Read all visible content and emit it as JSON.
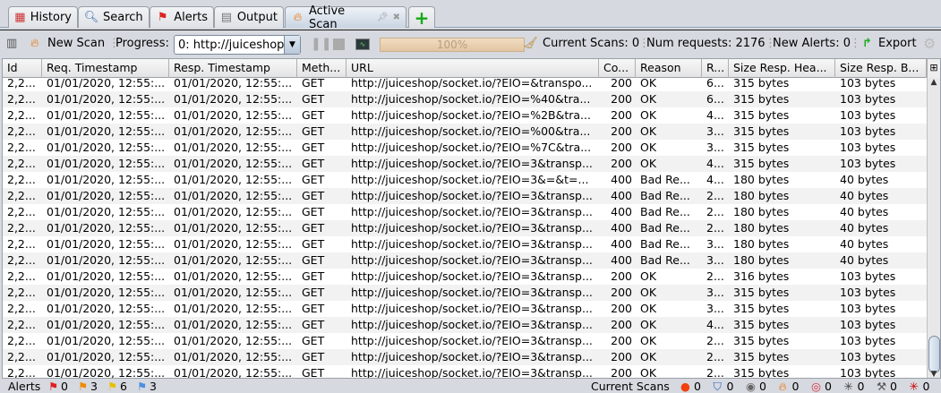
{
  "tabs": [
    {
      "label": "History",
      "icon": "calendar-icon"
    },
    {
      "label": "Search",
      "icon": "magnifier-icon"
    },
    {
      "label": "Alerts",
      "icon": "flag-icon"
    },
    {
      "label": "Output",
      "icon": "document-icon"
    },
    {
      "label": "Active Scan",
      "icon": "flame-icon",
      "active": true
    }
  ],
  "toolbar": {
    "new_scan": "New Scan",
    "progress_label": "Progress:",
    "progress_select": "0: http://juiceshop",
    "progress_value": "100%",
    "progress_percent": 100,
    "current_scans": "Current Scans: 0",
    "num_requests": "Num requests: 2176",
    "new_alerts": "New Alerts: 0",
    "export": "Export"
  },
  "table": {
    "columns": [
      "Id",
      "Req. Timestamp",
      "Resp. Timestamp",
      "Meth...",
      "URL",
      "Co...",
      "Reason",
      "R...",
      "Size Resp. Hea...",
      "Size Resp. B..."
    ],
    "rows": [
      [
        "2,2...",
        "01/01/2020, 12:55:...",
        "01/01/2020, 12:55:...",
        "GET",
        "http://juiceshop/socket.io/?EIO=&transpo...",
        "200",
        "OK",
        "6...",
        "315 bytes",
        "103 bytes"
      ],
      [
        "2,2...",
        "01/01/2020, 12:55:...",
        "01/01/2020, 12:55:...",
        "GET",
        "http://juiceshop/socket.io/?EIO=%40&tra...",
        "200",
        "OK",
        "6...",
        "315 bytes",
        "103 bytes"
      ],
      [
        "2,2...",
        "01/01/2020, 12:55:...",
        "01/01/2020, 12:55:...",
        "GET",
        "http://juiceshop/socket.io/?EIO=%2B&tra...",
        "200",
        "OK",
        "4...",
        "315 bytes",
        "103 bytes"
      ],
      [
        "2,2...",
        "01/01/2020, 12:55:...",
        "01/01/2020, 12:55:...",
        "GET",
        "http://juiceshop/socket.io/?EIO=%00&tra...",
        "200",
        "OK",
        "3...",
        "315 bytes",
        "103 bytes"
      ],
      [
        "2,2...",
        "01/01/2020, 12:55:...",
        "01/01/2020, 12:55:...",
        "GET",
        "http://juiceshop/socket.io/?EIO=%7C&tra...",
        "200",
        "OK",
        "3...",
        "315 bytes",
        "103 bytes"
      ],
      [
        "2,2...",
        "01/01/2020, 12:55:...",
        "01/01/2020, 12:55:...",
        "GET",
        "http://juiceshop/socket.io/?EIO=3&transp...",
        "200",
        "OK",
        "4...",
        "315 bytes",
        "103 bytes"
      ],
      [
        "2,2...",
        "01/01/2020, 12:55:...",
        "01/01/2020, 12:55:...",
        "GET",
        "http://juiceshop/socket.io/?EIO=3&=&t=...",
        "400",
        "Bad Re...",
        "4...",
        "180 bytes",
        "40 bytes"
      ],
      [
        "2,2...",
        "01/01/2020, 12:55:...",
        "01/01/2020, 12:55:...",
        "GET",
        "http://juiceshop/socket.io/?EIO=3&transp...",
        "400",
        "Bad Re...",
        "2...",
        "180 bytes",
        "40 bytes"
      ],
      [
        "2,2...",
        "01/01/2020, 12:55:...",
        "01/01/2020, 12:55:...",
        "GET",
        "http://juiceshop/socket.io/?EIO=3&transp...",
        "400",
        "Bad Re...",
        "2...",
        "180 bytes",
        "40 bytes"
      ],
      [
        "2,2...",
        "01/01/2020, 12:55:...",
        "01/01/2020, 12:55:...",
        "GET",
        "http://juiceshop/socket.io/?EIO=3&transp...",
        "400",
        "Bad Re...",
        "2...",
        "180 bytes",
        "40 bytes"
      ],
      [
        "2,2...",
        "01/01/2020, 12:55:...",
        "01/01/2020, 12:55:...",
        "GET",
        "http://juiceshop/socket.io/?EIO=3&transp...",
        "400",
        "Bad Re...",
        "3...",
        "180 bytes",
        "40 bytes"
      ],
      [
        "2,2...",
        "01/01/2020, 12:55:...",
        "01/01/2020, 12:55:...",
        "GET",
        "http://juiceshop/socket.io/?EIO=3&transp...",
        "400",
        "Bad Re...",
        "3...",
        "180 bytes",
        "40 bytes"
      ],
      [
        "2,2...",
        "01/01/2020, 12:55:...",
        "01/01/2020, 12:55:...",
        "GET",
        "http://juiceshop/socket.io/?EIO=3&transp...",
        "200",
        "OK",
        "2...",
        "316 bytes",
        "103 bytes"
      ],
      [
        "2,2...",
        "01/01/2020, 12:55:...",
        "01/01/2020, 12:55:...",
        "GET",
        "http://juiceshop/socket.io/?EIO=3&transp...",
        "200",
        "OK",
        "3...",
        "315 bytes",
        "103 bytes"
      ],
      [
        "2,2...",
        "01/01/2020, 12:55:...",
        "01/01/2020, 12:55:...",
        "GET",
        "http://juiceshop/socket.io/?EIO=3&transp...",
        "200",
        "OK",
        "3...",
        "315 bytes",
        "103 bytes"
      ],
      [
        "2,2...",
        "01/01/2020, 12:55:...",
        "01/01/2020, 12:55:...",
        "GET",
        "http://juiceshop/socket.io/?EIO=3&transp...",
        "200",
        "OK",
        "4...",
        "315 bytes",
        "103 bytes"
      ],
      [
        "2,2...",
        "01/01/2020, 12:55:...",
        "01/01/2020, 12:55:...",
        "GET",
        "http://juiceshop/socket.io/?EIO=3&transp...",
        "200",
        "OK",
        "2...",
        "315 bytes",
        "103 bytes"
      ],
      [
        "2,2...",
        "01/01/2020, 12:55:...",
        "01/01/2020, 12:55:...",
        "GET",
        "http://juiceshop/socket.io/?EIO=3&transp...",
        "200",
        "OK",
        "2...",
        "315 bytes",
        "103 bytes"
      ],
      [
        "2,2...",
        "01/01/2020, 12:55:...",
        "01/01/2020, 12:55:...",
        "GET",
        "http://juiceshop/socket.io/?EIO=3&transp...",
        "200",
        "OK",
        "2...",
        "315 bytes",
        "103 bytes"
      ]
    ]
  },
  "status": {
    "alerts_label": "Alerts",
    "alert_counts": [
      {
        "color": "#e02020",
        "count": "0"
      },
      {
        "color": "#f08a00",
        "count": "3"
      },
      {
        "color": "#e8c000",
        "count": "6"
      },
      {
        "color": "#4a8ee0",
        "count": "3"
      }
    ],
    "current_scans_label": "Current Scans",
    "scan_counts": [
      "0",
      "0",
      "0",
      "0",
      "0",
      "0",
      "0",
      "0"
    ]
  }
}
